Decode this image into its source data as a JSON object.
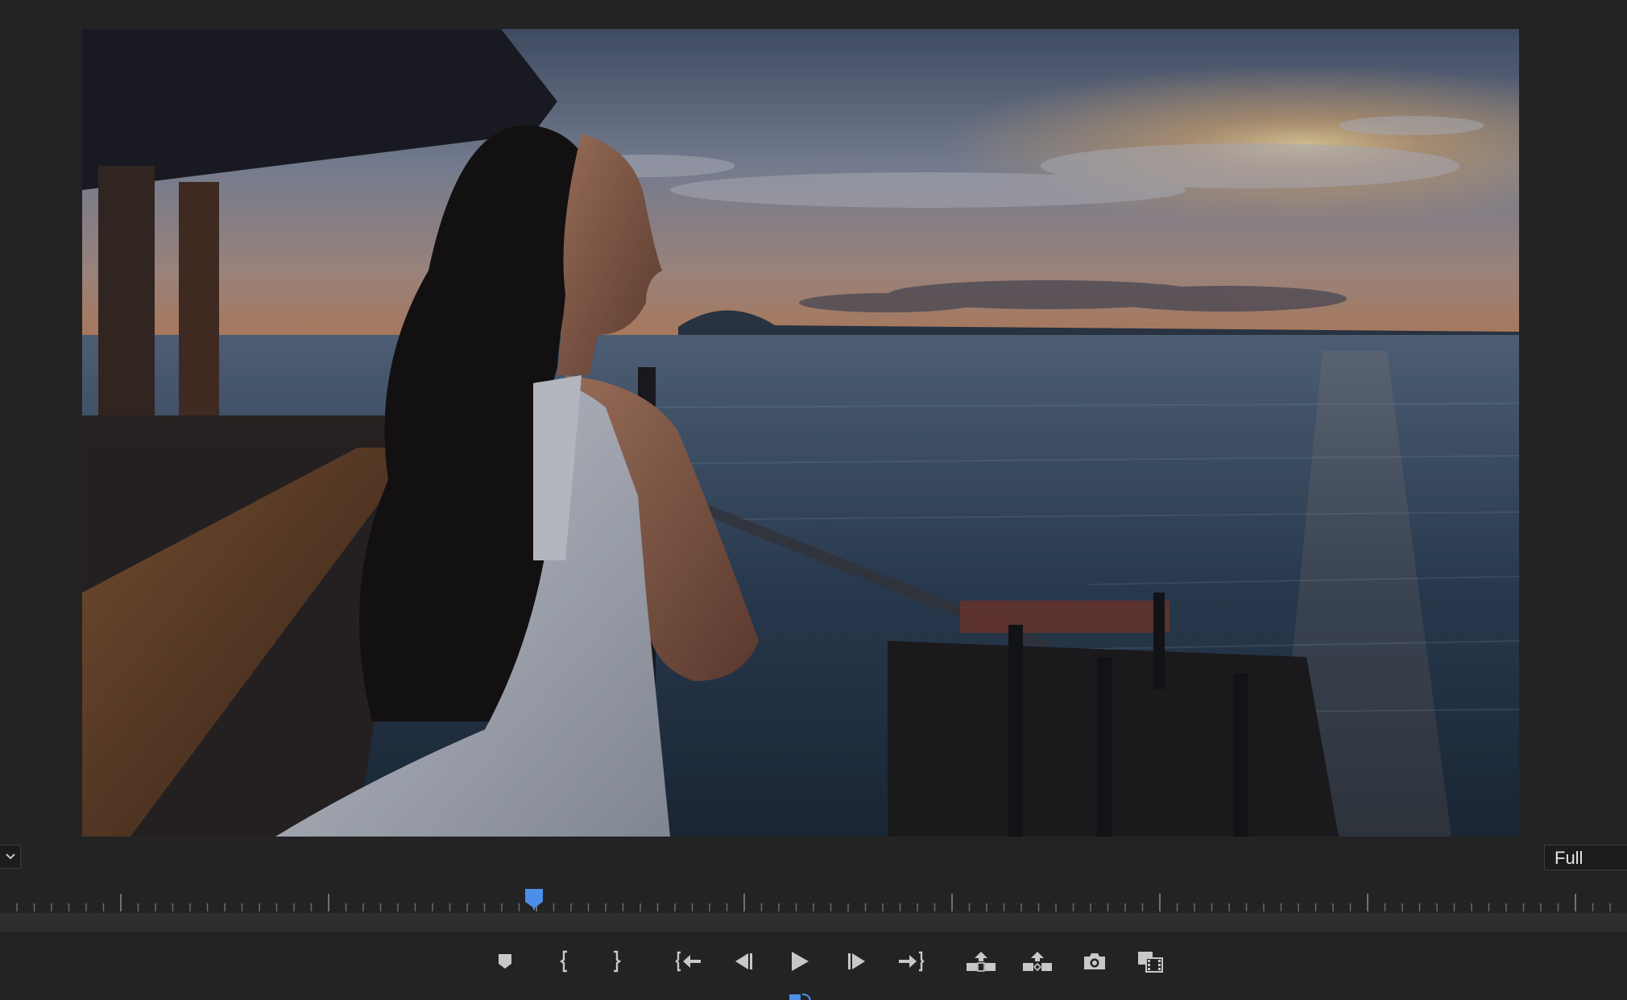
{
  "app": {
    "panel": "program-monitor"
  },
  "colors": {
    "background": "#232323",
    "accent": "#4c8fe8",
    "icon": "#c8c8c8"
  },
  "viewer": {
    "zoom_icon": "chevron-down-icon",
    "quality": "Full"
  },
  "timeline": {
    "playhead_fraction": 0.328
  },
  "transport": {
    "buttons": [
      {
        "name": "add-marker-button",
        "icon": "marker-icon"
      },
      {
        "name": "mark-in-button",
        "icon": "mark-in-icon"
      },
      {
        "name": "mark-out-button",
        "icon": "mark-out-icon"
      },
      {
        "name": "go-to-in-button",
        "icon": "go-to-in-icon"
      },
      {
        "name": "step-back-button",
        "icon": "step-back-icon"
      },
      {
        "name": "play-button",
        "icon": "play-icon"
      },
      {
        "name": "step-forward-button",
        "icon": "step-forward-icon"
      },
      {
        "name": "go-to-out-button",
        "icon": "go-to-out-icon"
      },
      {
        "name": "lift-button",
        "icon": "lift-icon"
      },
      {
        "name": "extract-button",
        "icon": "extract-icon"
      },
      {
        "name": "export-frame-button",
        "icon": "camera-icon"
      },
      {
        "name": "comparison-view-button",
        "icon": "comparison-view-icon"
      }
    ]
  }
}
